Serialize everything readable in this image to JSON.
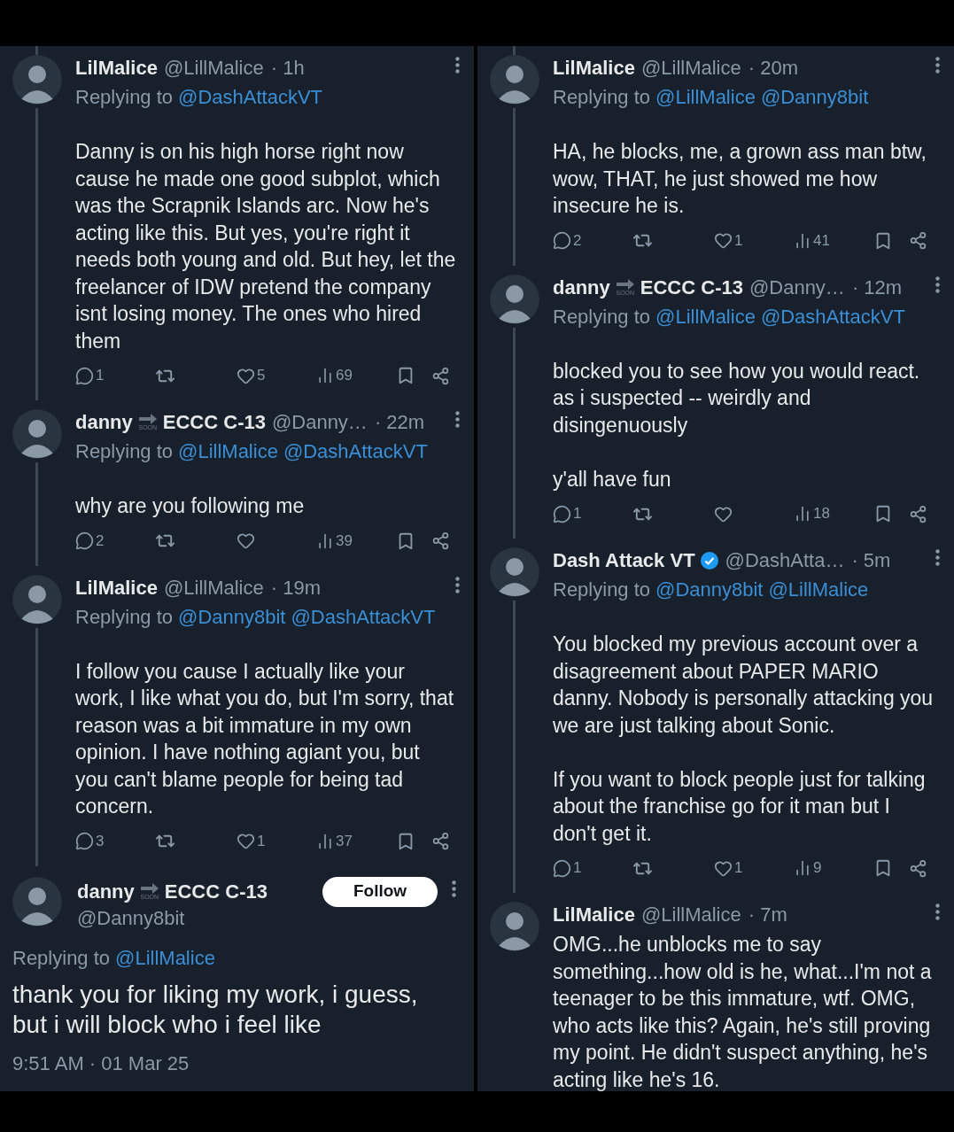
{
  "columns": [
    {
      "tweets": [
        {
          "kind": "reply",
          "connected_above": true,
          "thread_line": true,
          "name": "LilMalice",
          "handle": "@LillMalice",
          "time": "· 1h",
          "verified": false,
          "replying_label": "Replying to",
          "replying_to": [
            "@DashAttackVT"
          ],
          "body": [
            "Danny is on his high horse right now cause he made one good subplot, which was the Scrapnik Islands arc. Now he's acting like this. But yes, you're right it needs both young and old. But hey, let the freelancer of IDW pretend the company isnt losing money. The ones who hired them"
          ],
          "actions": {
            "replies": "1",
            "likes": "5",
            "views": "69"
          }
        },
        {
          "kind": "reply",
          "connected_above": false,
          "thread_line": true,
          "name": "danny",
          "badge_label": "SOON",
          "name_suffix": "ECCC C-13",
          "handle": "@Danny…",
          "time": "· 22m",
          "verified": false,
          "replying_label": "Replying to",
          "replying_to": [
            "@LillMalice",
            "@DashAttackVT"
          ],
          "body": [
            "why are you following me"
          ],
          "actions": {
            "replies": "2",
            "views": "39"
          }
        },
        {
          "kind": "reply",
          "connected_above": false,
          "thread_line": true,
          "name": "LilMalice",
          "handle": "@LillMalice",
          "time": "· 19m",
          "verified": false,
          "replying_label": "Replying to",
          "replying_to": [
            "@Danny8bit",
            "@DashAttackVT"
          ],
          "body": [
            "I follow you cause I actually like your work, I like what you do, but I'm sorry, that reason was a bit immature in my own opinion. I have nothing agiant you, but you can't blame people for being tad concern."
          ],
          "actions": {
            "replies": "3",
            "likes": "1",
            "views": "37"
          }
        },
        {
          "kind": "focused",
          "connected_above": false,
          "thread_line": false,
          "name": "danny",
          "badge_label": "SOON",
          "name_suffix": "ECCC C-13",
          "handle": "@Danny8bit",
          "verified": false,
          "follow_label": "Follow",
          "replying_label": "Replying to",
          "replying_to": [
            "@LillMalice"
          ],
          "body": [
            "thank you for liking my work, i guess, but i will block who i feel like"
          ],
          "timestamp": "9:51 AM · 01 Mar 25"
        }
      ]
    },
    {
      "tweets": [
        {
          "kind": "reply",
          "connected_above": true,
          "thread_line": true,
          "name": "LilMalice",
          "handle": "@LillMalice",
          "time": "· 20m",
          "verified": false,
          "replying_label": "Replying to",
          "replying_to": [
            "@LillMalice",
            "@Danny8bit"
          ],
          "body": [
            "HA, he blocks, me, a grown ass man btw, wow, THAT, he just showed me how insecure he is."
          ],
          "actions": {
            "replies": "2",
            "likes": "1",
            "views": "41"
          }
        },
        {
          "kind": "reply",
          "connected_above": false,
          "thread_line": true,
          "name": "danny",
          "badge_label": "SOON",
          "name_suffix": "ECCC C-13",
          "handle": "@Danny…",
          "time": "· 12m",
          "verified": false,
          "replying_label": "Replying to",
          "replying_to": [
            "@LillMalice",
            "@DashAttackVT"
          ],
          "body": [
            "blocked you to see how you would react. as i suspected -- weirdly and disingenuously",
            "y'all have fun"
          ],
          "actions": {
            "replies": "1",
            "views": "18"
          }
        },
        {
          "kind": "reply",
          "connected_above": false,
          "thread_line": true,
          "name": "Dash Attack VT",
          "handle": "@DashAtta…",
          "time": "· 5m",
          "verified": true,
          "replying_label": "Replying to",
          "replying_to": [
            "@Danny8bit",
            "@LillMalice"
          ],
          "body": [
            "You blocked my previous account over a disagreement about PAPER MARIO danny. Nobody is personally attacking you we are just talking about Sonic.",
            "If you want to block people just for talking about the franchise go for it man but I don't get it."
          ],
          "actions": {
            "replies": "1",
            "likes": "1",
            "views": "9"
          }
        },
        {
          "kind": "reply",
          "connected_above": false,
          "thread_line": false,
          "name": "LilMalice",
          "handle": "@LillMalice",
          "time": "· 7m",
          "verified": false,
          "body": [
            "OMG...he unblocks me to say something...how old is he, what...I'm not a teenager to be this immature, wtf. OMG, who acts like this? Again, he's still proving my point. He didn't suspect anything, he's acting like he's 16."
          ]
        }
      ]
    }
  ]
}
